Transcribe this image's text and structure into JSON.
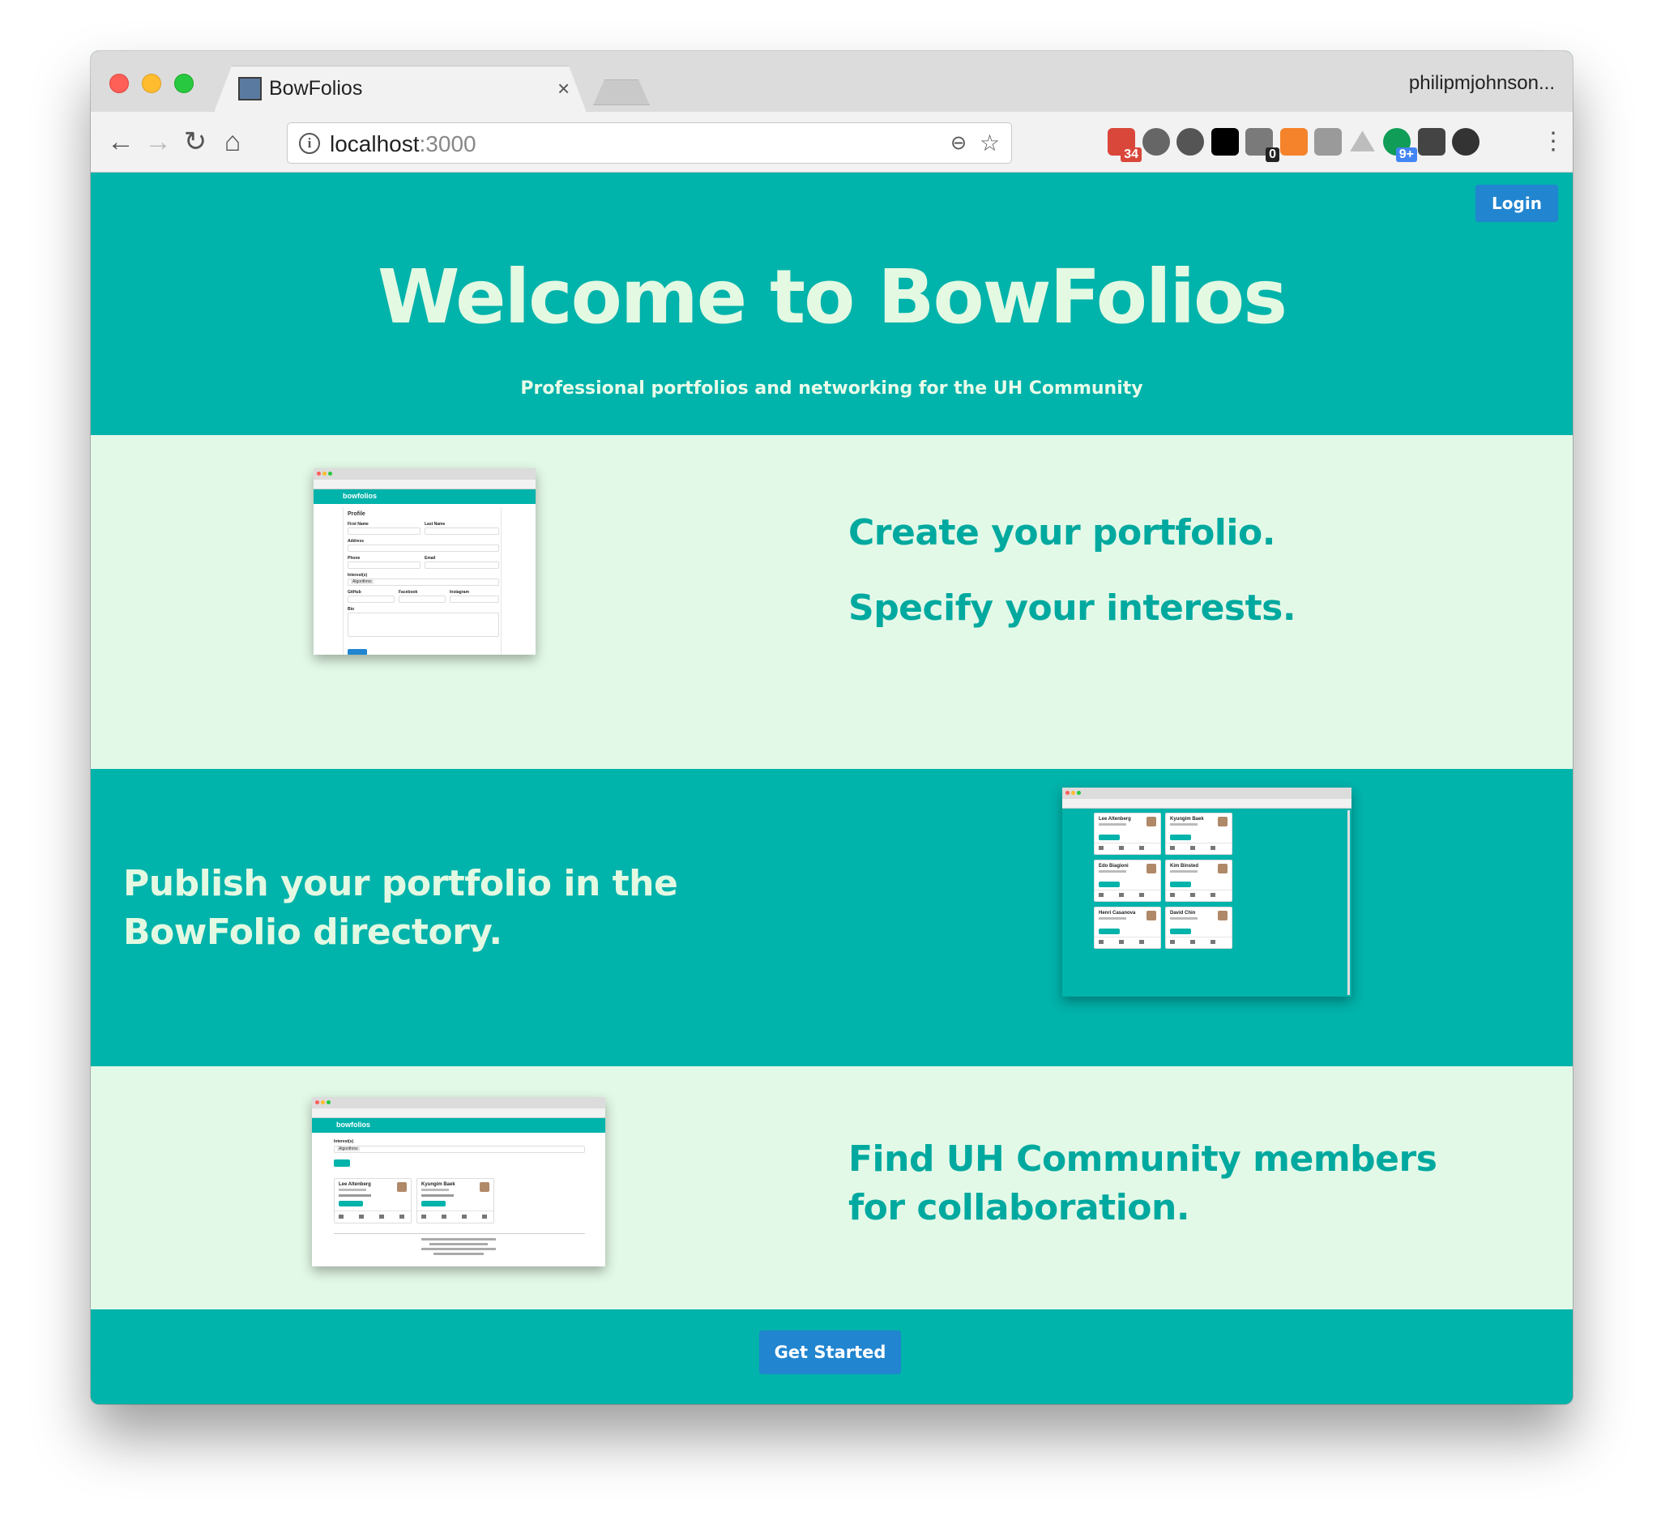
{
  "browser": {
    "tab_title": "BowFolios",
    "tab_close": "×",
    "profile": "philipmjohnson...",
    "url_host": "localhost",
    "url_port": ":3000",
    "nav": {
      "back": "←",
      "forward": "→",
      "reload": "↻",
      "home": "⌂"
    },
    "omnibox_icons": {
      "zoom": "🔍",
      "bookmark": "☆"
    },
    "extensions": [
      {
        "name": "ext-calendar-icon",
        "badge": "34",
        "color": "#d9473b",
        "badge_color": "#d9473b"
      },
      {
        "name": "ext-sync-icon",
        "badge": "",
        "color": "#666666"
      },
      {
        "name": "ext-1password-icon",
        "badge": "",
        "color": "#555555"
      },
      {
        "name": "ext-jetbrains-icon",
        "badge": "",
        "color": "#000000"
      },
      {
        "name": "ext-ghostery-icon",
        "badge": "0",
        "color": "#7a7a7a",
        "badge_color": "#222222"
      },
      {
        "name": "ext-analytics-icon",
        "badge": "",
        "color": "#f5832b"
      },
      {
        "name": "ext-link-icon",
        "badge": "",
        "color": "#9a9a9a"
      },
      {
        "name": "ext-drive-icon",
        "badge": "",
        "color": "#bdbdbd"
      },
      {
        "name": "ext-hangouts-icon",
        "badge": "9+",
        "color": "#0f9d58",
        "badge_color": "#4285f4"
      },
      {
        "name": "ext-eyedropper-icon",
        "badge": "",
        "color": "#444444"
      },
      {
        "name": "ext-camera-icon",
        "badge": "",
        "color": "#333333"
      }
    ],
    "menu": "⋮"
  },
  "page": {
    "login_label": "Login",
    "hero_title": "Welcome to BowFolios",
    "hero_subtitle": "Professional portfolios and networking for the UH Community",
    "feature_1_line_1": "Create your portfolio.",
    "feature_1_line_2": "Specify your interests.",
    "feature_2": "Publish your portfolio in the BowFolio directory.",
    "feature_3": "Find UH Community members for collaboration.",
    "get_started_label": "Get Started"
  },
  "thumbnails": {
    "profile": {
      "brand": "bowfolios",
      "heading": "Profile",
      "labels": [
        "First Name",
        "Last Name",
        "Address",
        "Phone",
        "Email",
        "Interest(s)",
        "GitHub",
        "Facebook",
        "Instagram",
        "Bio"
      ],
      "tag": "Algorithms",
      "submit": "Submit"
    },
    "directory": {
      "cards": [
        "Lee Altenberg",
        "Kyungim Baek",
        "Edo Biagioni",
        "Kim Binsted",
        "Henri Casanova",
        "David Chin"
      ]
    },
    "filter": {
      "brand": "bowfolios",
      "filter_label": "Interest(s)",
      "tag": "Algorithms",
      "cards": [
        "Lee Altenberg",
        "Kyungim Baek"
      ]
    }
  },
  "colors": {
    "teal": "#00b3ab",
    "light_green": "#e3f9e7",
    "button_blue": "#2185d0"
  }
}
